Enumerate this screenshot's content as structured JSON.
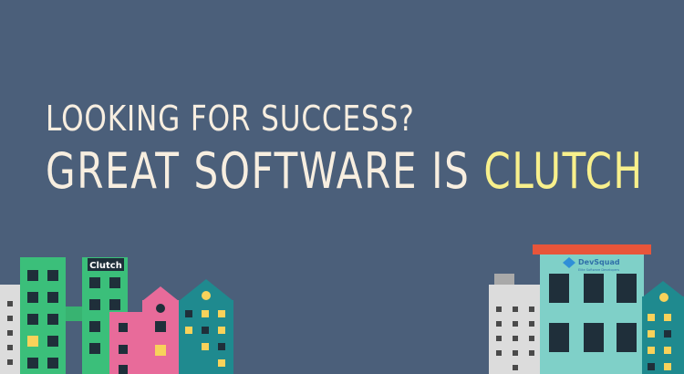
{
  "headline": {
    "line1": "LOOKING FOR SUCCESS?",
    "line2_prefix": "GREAT SOFTWARE IS ",
    "line2_highlight": "CLUTCH"
  },
  "signs": {
    "clutch": "Clutch",
    "devsquad": "DevSquad",
    "devsquad_tagline": "Elite Software Developers"
  },
  "colors": {
    "background": "#4b5f7a",
    "text": "#f7eee0",
    "highlight": "#f8f08c",
    "green_building": "#3bbf7a",
    "pink_building": "#e86b9a",
    "teal_building": "#1f8a8f",
    "roof_orange": "#e8553a",
    "light_teal": "#7fd0c8"
  }
}
